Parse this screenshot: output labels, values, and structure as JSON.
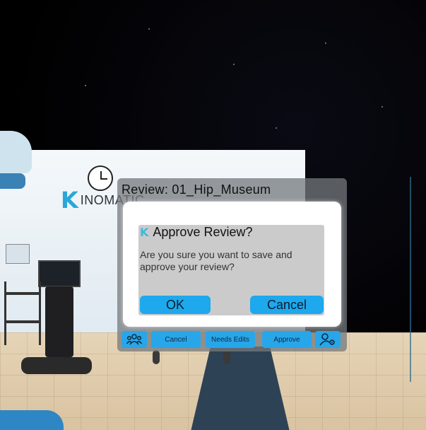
{
  "scene": {
    "logo_text": "INOMATIC",
    "logo_mark": "K"
  },
  "review_panel": {
    "title": "Review: 01_Hip_Museum"
  },
  "dialog": {
    "icon": "K",
    "title": "Approve Review?",
    "message": "Are you sure you want to save and approve your review?",
    "ok_label": "OK",
    "cancel_label": "Cancel"
  },
  "toolbar": {
    "group_icon": "group-icon",
    "cancel_label": "Cancel",
    "needs_edits_label": "Needs Edits",
    "approve_label": "Approve",
    "user_settings_icon": "user-settings-icon"
  },
  "colors": {
    "accent": "#1ea8ee",
    "panel": "#74787c",
    "modal": "#ffffff",
    "modal_inner": "#cbcbcb"
  }
}
